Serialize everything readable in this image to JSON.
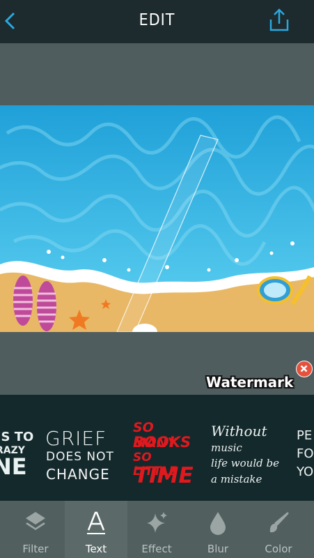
{
  "header": {
    "title": "EDIT"
  },
  "editor": {
    "watermark_label": "Watermark"
  },
  "templates": [
    {
      "id": "partial-left",
      "lines": [
        "'S TO",
        "RAZY",
        "NE"
      ]
    },
    {
      "id": "grief",
      "lines": [
        "GRIEF",
        "DOES NOT",
        "CHANGE"
      ]
    },
    {
      "id": "so-many-books",
      "lines": [
        "SO MANY",
        "BOOKS",
        "SO LITTLE",
        "TIME"
      ]
    },
    {
      "id": "without-music",
      "lines": [
        "Without",
        "music",
        "life would be",
        "a mistake"
      ]
    },
    {
      "id": "partial-right",
      "lines": [
        "PE",
        "FO",
        "YO"
      ]
    }
  ],
  "tabs": [
    {
      "label": "Filter",
      "icon": "layers-icon",
      "active": false
    },
    {
      "label": "Text",
      "icon": "text-icon",
      "active": true
    },
    {
      "label": "Effect",
      "icon": "sparkle-icon",
      "active": false
    },
    {
      "label": "Blur",
      "icon": "droplet-icon",
      "active": false
    },
    {
      "label": "Color",
      "icon": "paintbrush-icon",
      "active": false
    }
  ],
  "colors": {
    "accent": "#29a8e0",
    "close": "#e4523e",
    "topbar": "#1d2a2e",
    "strip": "#14292c"
  }
}
